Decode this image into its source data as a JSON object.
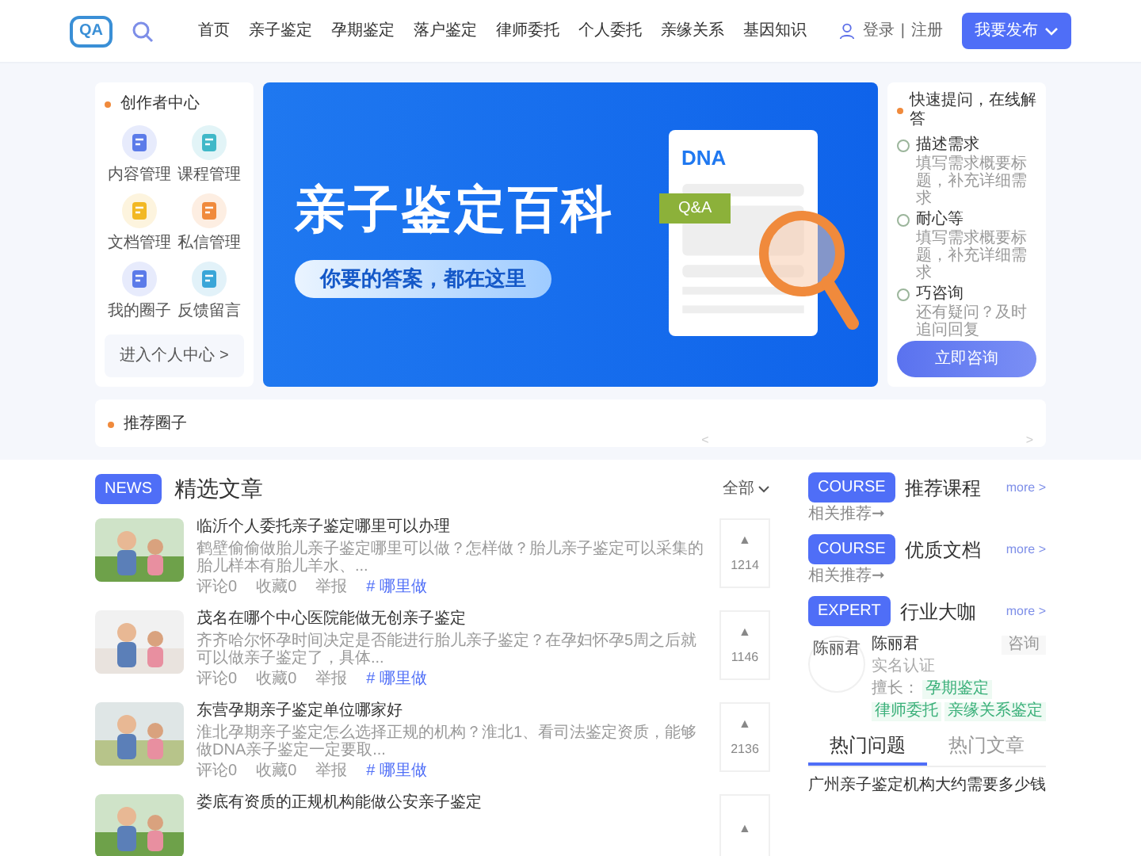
{
  "header": {
    "logo": "QA",
    "nav": [
      "首页",
      "亲子鉴定",
      "孕期鉴定",
      "落户鉴定",
      "律师委托",
      "个人委托",
      "亲缘关系",
      "基因知识"
    ],
    "login": "登录",
    "separator": "|",
    "register": "注册",
    "publish": "我要发布"
  },
  "creator": {
    "title": "创作者中心",
    "items": [
      {
        "label": "内容管理",
        "color": "#5b7be9"
      },
      {
        "label": "课程管理",
        "color": "#3fb8c8"
      },
      {
        "label": "文档管理",
        "color": "#f2b824"
      },
      {
        "label": "私信管理",
        "color": "#f08a3c"
      },
      {
        "label": "我的圈子",
        "color": "#5b7be9"
      },
      {
        "label": "反馈留言",
        "color": "#3aa6d8"
      }
    ],
    "enter": "进入个人中心 >"
  },
  "banner": {
    "title": "亲子鉴定百科",
    "subtitle": "你要的答案，都在这里",
    "doc_title": "DNA",
    "tag": "Q&A"
  },
  "quick": {
    "title": "快速提问，在线解答",
    "steps": [
      {
        "name": "描述需求",
        "desc": "填写需求概要标题，补充详细需求"
      },
      {
        "name": "耐心等",
        "desc": "填写需求概要标题，补充详细需求"
      },
      {
        "name": "巧咨询",
        "desc": "还有疑问？及时追问回复"
      }
    ],
    "button": "立即咨询"
  },
  "circles": {
    "title": "推荐圈子",
    "prev": "<",
    "next": ">"
  },
  "articles": {
    "badge": "NEWS",
    "title": "精选文章",
    "filter": "全部",
    "items": [
      {
        "title": "临沂个人委托亲子鉴定哪里可以办理",
        "excerpt": "鹤壁偷偷做胎儿亲子鉴定哪里可以做？怎样做？胎儿亲子鉴定可以采集的胎儿样本有胎儿羊水、...",
        "comments": "评论0",
        "favorites": "收藏0",
        "report": "举报",
        "tag": "# 哪里做",
        "up": "▲",
        "votes": "1214"
      },
      {
        "title": "茂名在哪个中心医院能做无创亲子鉴定",
        "excerpt": "齐齐哈尔怀孕时间决定是否能进行胎儿亲子鉴定？在孕妇怀孕5周之后就可以做亲子鉴定了，具体...",
        "comments": "评论0",
        "favorites": "收藏0",
        "report": "举报",
        "tag": "# 哪里做",
        "up": "▲",
        "votes": "1146"
      },
      {
        "title": "东营孕期亲子鉴定单位哪家好",
        "excerpt": "淮北孕期亲子鉴定怎么选择正规的机构？淮北1、看司法鉴定资质，能够做DNA亲子鉴定一定要取...",
        "comments": "评论0",
        "favorites": "收藏0",
        "report": "举报",
        "tag": "# 哪里做",
        "up": "▲",
        "votes": "2136"
      },
      {
        "title": "娄底有资质的正规机构能做公安亲子鉴定",
        "up": "▲"
      }
    ]
  },
  "sections": [
    {
      "badge": "COURSE",
      "title": "推荐课程",
      "more": "more >",
      "sub": "相关推荐➞"
    },
    {
      "badge": "COURSE",
      "title": "优质文档",
      "more": "more >",
      "sub": "相关推荐➞"
    }
  ],
  "experts": {
    "badge": "EXPERT",
    "title": "行业大咖",
    "more": "more >",
    "person": {
      "avatar_text": "陈丽君",
      "name": "陈丽君",
      "verified": "实名认证",
      "consult": "咨询",
      "skill_label": "擅长：",
      "skills": [
        "孕期鉴定",
        "律师委托",
        "亲缘关系鉴定"
      ]
    }
  },
  "hot": {
    "tabs": [
      {
        "label": "热门问题",
        "selected": true
      },
      {
        "label": "热门文章",
        "selected": false
      }
    ],
    "items": [
      "广州亲子鉴定机构大约需要多少钱"
    ]
  }
}
